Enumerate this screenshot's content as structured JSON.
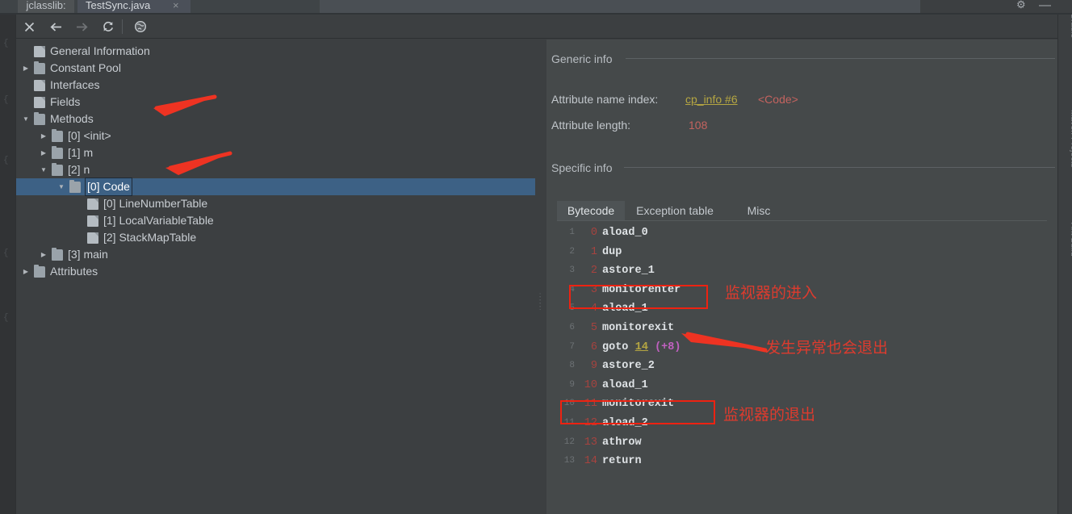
{
  "window": {
    "tabs": [
      {
        "label": "jclasslib:",
        "active": false
      },
      {
        "label": "TestSync.java",
        "active": true
      }
    ],
    "close_glyph": "×",
    "gear_glyph": "⚙",
    "minimize_glyph": "—",
    "right_rail": [
      "Gradle",
      "Maven Projects",
      "Ant Build"
    ]
  },
  "toolbar": {
    "close_label": "✕",
    "back_label": "←",
    "forward_label": "→",
    "refresh_label": "⟳",
    "browse_label": "ἱ0"
  },
  "tree": {
    "items": [
      {
        "label": "General Information",
        "indent": 0,
        "icon": "file-icon",
        "twisty": "none",
        "selected": false
      },
      {
        "label": "Constant Pool",
        "indent": 0,
        "icon": "folder-icon",
        "twisty": "collapsed",
        "selected": false
      },
      {
        "label": "Interfaces",
        "indent": 0,
        "icon": "file-icon",
        "twisty": "none",
        "selected": false
      },
      {
        "label": "Fields",
        "indent": 0,
        "icon": "file-icon",
        "twisty": "none",
        "selected": false
      },
      {
        "label": "Methods",
        "indent": 0,
        "icon": "folder-icon",
        "twisty": "expanded",
        "selected": false
      },
      {
        "label": "[0] <init>",
        "indent": 1,
        "icon": "folder-icon",
        "twisty": "collapsed",
        "selected": false
      },
      {
        "label": "[1] m",
        "indent": 1,
        "icon": "folder-icon",
        "twisty": "collapsed",
        "selected": false
      },
      {
        "label": "[2] n",
        "indent": 1,
        "icon": "folder-icon",
        "twisty": "expanded",
        "selected": false
      },
      {
        "label": "[0] Code",
        "indent": 2,
        "icon": "folder-icon",
        "twisty": "expanded",
        "selected": true
      },
      {
        "label": "[0] LineNumberTable",
        "indent": 3,
        "icon": "file-icon",
        "twisty": "none",
        "selected": false
      },
      {
        "label": "[1] LocalVariableTable",
        "indent": 3,
        "icon": "file-icon",
        "twisty": "none",
        "selected": false
      },
      {
        "label": "[2] StackMapTable",
        "indent": 3,
        "icon": "file-icon",
        "twisty": "none",
        "selected": false
      },
      {
        "label": "[3] main",
        "indent": 1,
        "icon": "folder-icon",
        "twisty": "collapsed",
        "selected": false
      },
      {
        "label": "Attributes",
        "indent": 0,
        "icon": "folder-icon",
        "twisty": "collapsed",
        "selected": false
      }
    ]
  },
  "detail": {
    "generic_info_heading": "Generic info",
    "specific_info_heading": "Specific info",
    "attribute_name_index_label": "Attribute name index:",
    "attribute_name_index_link": "cp_info #6",
    "attribute_name_index_value": "<Code>",
    "attribute_length_label": "Attribute length:",
    "attribute_length_value": "108",
    "tabs": [
      {
        "label": "Bytecode",
        "active": true
      },
      {
        "label": "Exception table",
        "active": false
      },
      {
        "label": "Misc",
        "active": false
      }
    ]
  },
  "bytecode": {
    "rows": [
      {
        "line": "1",
        "offset": "0",
        "mnemonic": "aload_0",
        "arg": "",
        "delta": ""
      },
      {
        "line": "2",
        "offset": "1",
        "mnemonic": "dup",
        "arg": "",
        "delta": ""
      },
      {
        "line": "3",
        "offset": "2",
        "mnemonic": "astore_1",
        "arg": "",
        "delta": ""
      },
      {
        "line": "4",
        "offset": "3",
        "mnemonic": "monitorenter",
        "arg": "",
        "delta": ""
      },
      {
        "line": "5",
        "offset": "4",
        "mnemonic": "aload_1",
        "arg": "",
        "delta": ""
      },
      {
        "line": "6",
        "offset": "5",
        "mnemonic": "monitorexit",
        "arg": "",
        "delta": ""
      },
      {
        "line": "7",
        "offset": "6",
        "mnemonic": "goto",
        "arg": "14",
        "delta": "(+8)"
      },
      {
        "line": "8",
        "offset": "9",
        "mnemonic": "astore_2",
        "arg": "",
        "delta": ""
      },
      {
        "line": "9",
        "offset": "10",
        "mnemonic": "aload_1",
        "arg": "",
        "delta": ""
      },
      {
        "line": "10",
        "offset": "11",
        "mnemonic": "monitorexit",
        "arg": "",
        "delta": ""
      },
      {
        "line": "11",
        "offset": "12",
        "mnemonic": "aload_2",
        "arg": "",
        "delta": ""
      },
      {
        "line": "12",
        "offset": "13",
        "mnemonic": "athrow",
        "arg": "",
        "delta": ""
      },
      {
        "line": "13",
        "offset": "14",
        "mnemonic": "return",
        "arg": "",
        "delta": ""
      }
    ]
  },
  "annotations": {
    "monitor_enter_note": "监视器的进入",
    "exception_exit_note": "发生异常也会退出",
    "monitor_exit_note": "监视器的退出",
    "accent_color": "#ee2211"
  }
}
